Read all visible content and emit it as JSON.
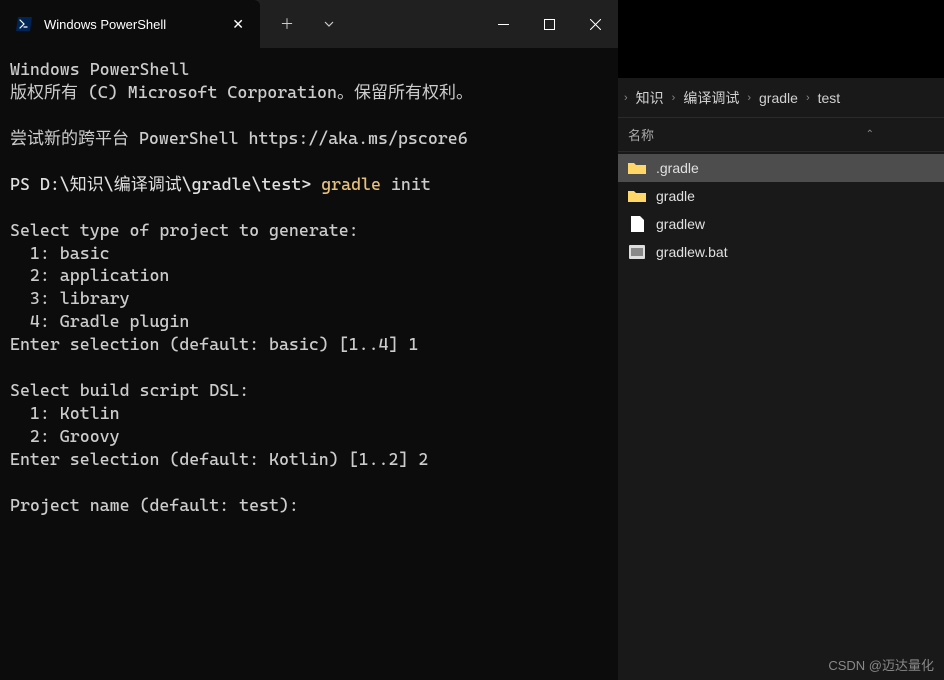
{
  "terminal": {
    "tab_title": "Windows PowerShell",
    "lines": {
      "l1": "Windows PowerShell",
      "l2": "版权所有 (C) Microsoft Corporation。保留所有权利。",
      "l3": "",
      "l4": "尝试新的跨平台 PowerShell https://aka.ms/pscore6",
      "l5": "",
      "prompt_path": "PS D:\\知识\\编译调试\\gradle\\test> ",
      "cmd_yellow": "gradle",
      "cmd_rest": " init",
      "l7": "",
      "l8": "Select type of project to generate:",
      "l9": "  1: basic",
      "l10": "  2: application",
      "l11": "  3: library",
      "l12": "  4: Gradle plugin",
      "l13": "Enter selection (default: basic) [1..4] 1",
      "l14": "",
      "l15": "Select build script DSL:",
      "l16": "  1: Kotlin",
      "l17": "  2: Groovy",
      "l18": "Enter selection (default: Kotlin) [1..2] 2",
      "l19": "",
      "l20": "Project name (default: test):"
    }
  },
  "explorer": {
    "breadcrumb": [
      "知识",
      "编译调试",
      "gradle",
      "test"
    ],
    "column_name": "名称",
    "items": [
      {
        "name": ".gradle",
        "type": "folder",
        "selected": true
      },
      {
        "name": "gradle",
        "type": "folder",
        "selected": false
      },
      {
        "name": "gradlew",
        "type": "file",
        "selected": false
      },
      {
        "name": "gradlew.bat",
        "type": "bat",
        "selected": false
      }
    ]
  },
  "watermark": "CSDN @迈达量化"
}
